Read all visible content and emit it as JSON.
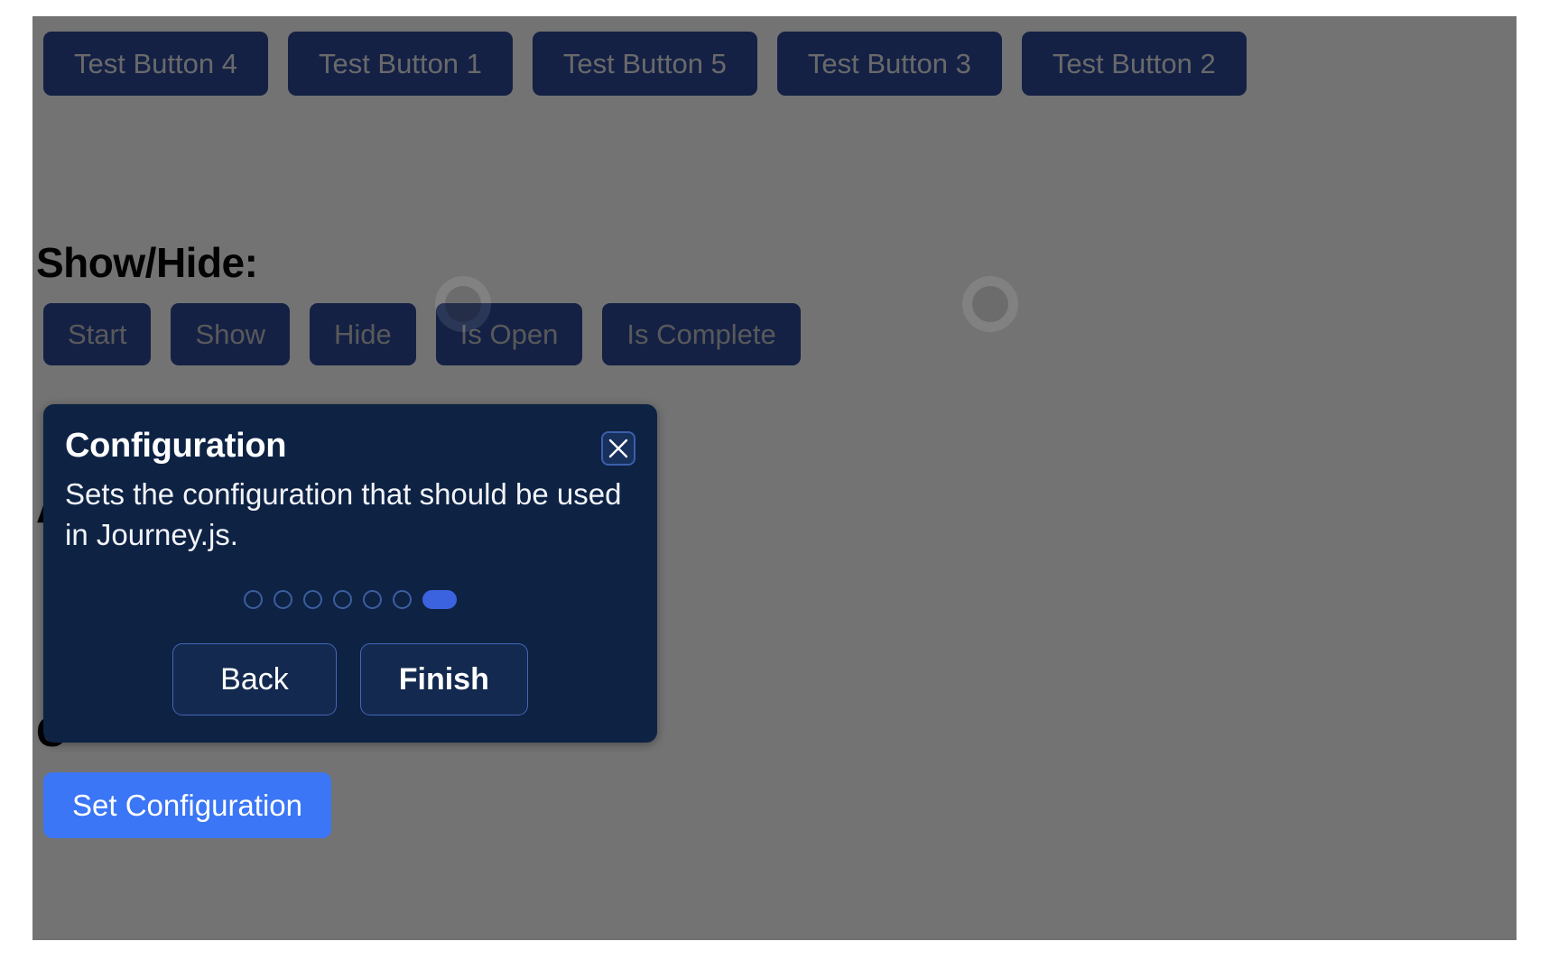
{
  "page": {
    "background_color": "#ffffff",
    "overlay_color": "rgba(0,0,0,0.55)"
  },
  "toolbar": {
    "buttons": [
      {
        "label": "Test Button 4"
      },
      {
        "label": "Test Button 1"
      },
      {
        "label": "Test Button 5"
      },
      {
        "label": "Test Button 3"
      },
      {
        "label": "Test Button 2"
      }
    ]
  },
  "sections": {
    "show_hide_heading": "Show/Hide:",
    "hidden_heading_a": "A",
    "hidden_heading_c": "C"
  },
  "controls": {
    "buttons": [
      {
        "label": "Start"
      },
      {
        "label": "Show"
      },
      {
        "label": "Hide"
      },
      {
        "label": "Is Open"
      },
      {
        "label": "Is Complete"
      }
    ]
  },
  "set_configuration": {
    "label": "Set Configuration",
    "color": "#3b76f6"
  },
  "dialog": {
    "title": "Configuration",
    "body": "Sets the configuration that should be used in Journey.js.",
    "close_icon": "close-x-icon",
    "background_color": "#0e2244",
    "progress": {
      "total": 7,
      "active_index": 6
    },
    "buttons": {
      "back": "Back",
      "finish": "Finish"
    }
  },
  "focus_rings": [
    {
      "name": "focus-ring-hide"
    },
    {
      "name": "focus-ring-is-complete"
    }
  ]
}
